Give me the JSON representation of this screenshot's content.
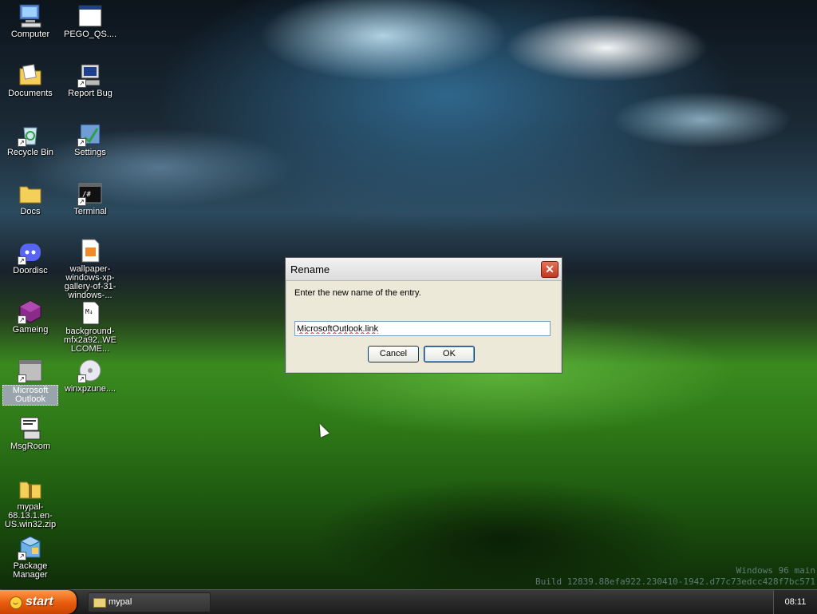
{
  "desktop": {
    "icons": [
      {
        "label": "Computer"
      },
      {
        "label": "PEGO_QS...."
      },
      {
        "label": "Documents"
      },
      {
        "label": "Report Bug"
      },
      {
        "label": "Recycle Bin"
      },
      {
        "label": "Settings"
      },
      {
        "label": "Docs"
      },
      {
        "label": "Terminal"
      },
      {
        "label": "Doordisc"
      },
      {
        "label": "wallpaper-windows-xp-gallery-of-31-windows-..."
      },
      {
        "label": "Gameing"
      },
      {
        "label": "background-mfx2a92..WELCOME..."
      },
      {
        "label": "Microsoft Outlook"
      },
      {
        "label": "winxpzune...."
      },
      {
        "label": "MsgRoom"
      },
      {
        "label": "mypal-68.13.1.en-US.win32.zip"
      },
      {
        "label": "Package Manager"
      }
    ],
    "build_line1": "Windows 96 main",
    "build_line2": "Build 12839.88efa922.230410-1942.d77c73edcc428f7bc571"
  },
  "dialog": {
    "title": "Rename",
    "prompt": "Enter the new name of the entry.",
    "input_value": "MicrosoftOutlook.link",
    "cancel_label": "Cancel",
    "ok_label": "OK"
  },
  "taskbar": {
    "start_label": "start",
    "tasks": [
      {
        "label": "mypal"
      }
    ],
    "clock": "08:11"
  }
}
